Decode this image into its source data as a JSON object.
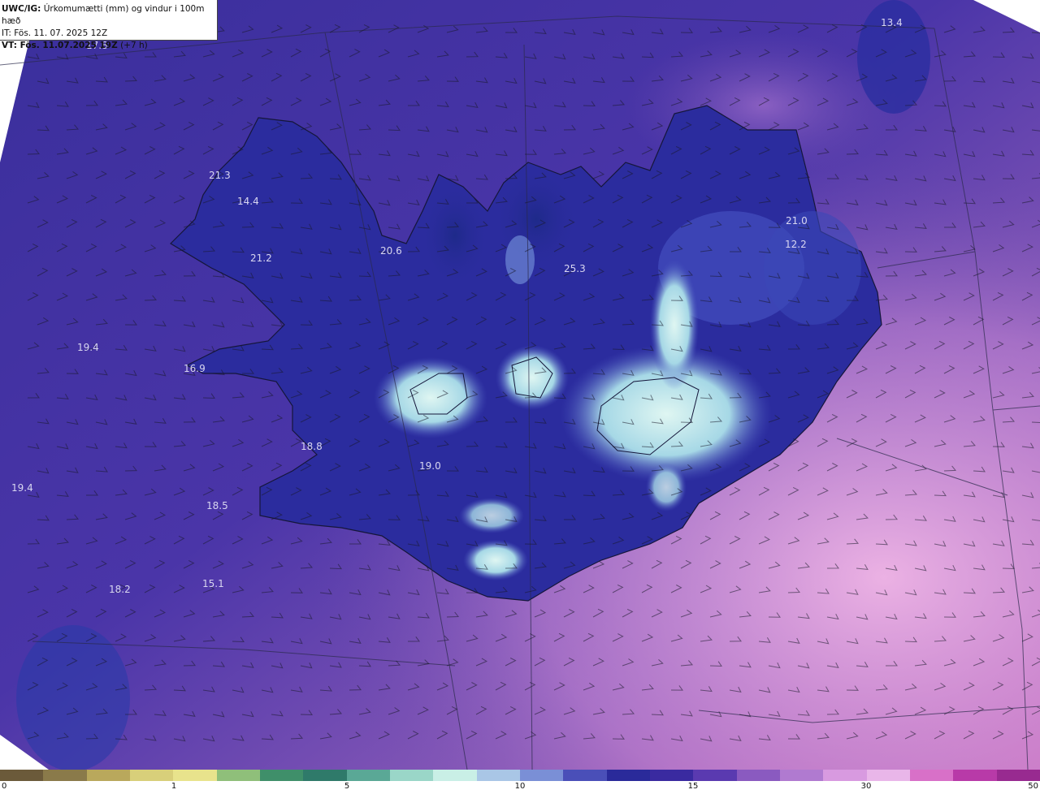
{
  "header": {
    "model": "UWC/IG:",
    "description": "Úrkomumætti (mm) og vindur i 100m hæð",
    "init_time": "IT: Fös. 11. 07. 2025 12Z",
    "valid_label": "VT: Fös. 11.07.2025 19Z",
    "valid_offset": "(+7 h)"
  },
  "value_labels": [
    {
      "id": "nw-corner",
      "text": "17.8"
    },
    {
      "id": "ne-corner",
      "text": "13.4"
    },
    {
      "id": "westfjords-north",
      "text": "21.3"
    },
    {
      "id": "westfjords-mid",
      "text": "14.4"
    },
    {
      "id": "westfjords-south",
      "text": "21.2"
    },
    {
      "id": "north-west",
      "text": "20.6"
    },
    {
      "id": "north-central",
      "text": "25.3"
    },
    {
      "id": "north-east",
      "text": "21.0"
    },
    {
      "id": "east",
      "text": "12.2"
    },
    {
      "id": "west-sea",
      "text": "19.4"
    },
    {
      "id": "snaefellsnes",
      "text": "16.9"
    },
    {
      "id": "west-coast",
      "text": "18.8"
    },
    {
      "id": "south-west",
      "text": "19.0"
    },
    {
      "id": "far-west-sea",
      "text": "19.4"
    },
    {
      "id": "reykjanes-sea",
      "text": "18.5"
    },
    {
      "id": "sw-sea",
      "text": "18.2"
    },
    {
      "id": "south-sea",
      "text": "15.1"
    }
  ],
  "colorbar": {
    "ticks": [
      "0",
      "1",
      "5",
      "10",
      "15",
      "30",
      "50"
    ],
    "colors": [
      "#6b5a3a",
      "#8a7a4a",
      "#b9a85c",
      "#d8cf7a",
      "#e8e38c",
      "#8fbf7a",
      "#3f8f6a",
      "#2f7a6a",
      "#5aa896",
      "#9ad6c8",
      "#c9efe6",
      "#a9c6e6",
      "#7a8fd6",
      "#4a4fb8",
      "#2a2a9a",
      "#3a2aa0",
      "#5a3ab0",
      "#8a5ac0",
      "#b07ad0",
      "#d89ae0",
      "#e9b6e9",
      "#d870c8",
      "#b83aa8",
      "#982a90"
    ]
  },
  "colors": {
    "sea_base": "#3d2f9a",
    "land_high": "#cfeef0",
    "land_mid": "#2a2a9a",
    "pink_high": "#e6a6e0",
    "coast": "#1a1a3a"
  }
}
